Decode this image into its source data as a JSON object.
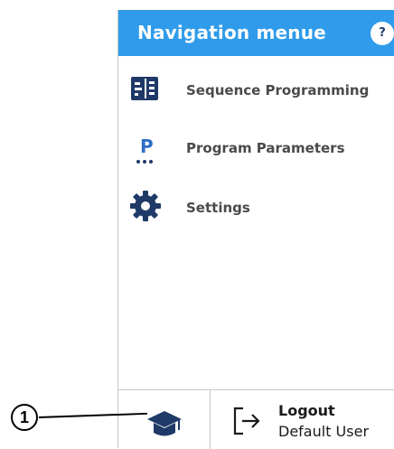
{
  "header": {
    "title": "Navigation menue",
    "help_label": "?"
  },
  "menu": {
    "items": [
      {
        "label": "Sequence Programming",
        "icon": "sequence-programming-icon"
      },
      {
        "label": "Program Parameters",
        "icon": "program-parameters-icon"
      },
      {
        "label": "Settings",
        "icon": "gear-icon"
      }
    ]
  },
  "footer": {
    "academy_icon": "graduation-cap-icon",
    "logout_label": "Logout",
    "user_name": "Default User",
    "logout_icon": "logout-icon"
  },
  "annotation": {
    "callout_number": "1"
  },
  "colors": {
    "header_bg": "#2f9bea",
    "icon_dark": "#1f3a68",
    "text_gray": "#4a4a4a"
  }
}
